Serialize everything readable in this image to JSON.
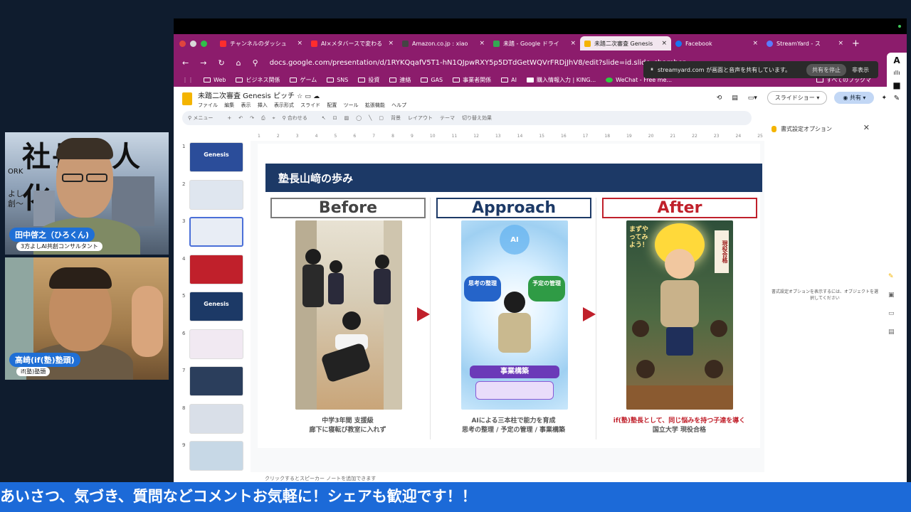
{
  "participants": [
    {
      "name": "田中啓之（ひろくん)",
      "role": "3方よしAI共創コンサルタント",
      "backdrop_text": "社長無人化",
      "backdrop_small": "ORK",
      "backdrop_small2": "よし\n創〜"
    },
    {
      "name": "高崎(if(塾)塾頭)",
      "role": "if(塾)塾頭"
    }
  ],
  "browser": {
    "tabs": [
      {
        "label": "チャンネルのダッシュ",
        "fav_color": "#ff2d2d"
      },
      {
        "label": "AI×メタバースで変わる",
        "fav_color": "#ff2d2d"
      },
      {
        "label": "Amazon.co.jp : xiao",
        "fav_color": "#333333"
      },
      {
        "label": "未踏 - Google ドライ",
        "fav_color": "#34a853"
      },
      {
        "label": "未踏二次審査 Genesis",
        "fav_color": "#f4b400"
      },
      {
        "label": "Facebook",
        "fav_color": "#1877f2"
      },
      {
        "label": "StreamYard - ス",
        "fav_color": "#5a7bff"
      }
    ],
    "url": "docs.google.com/presentation/d/1RYKQqafV5T1-hN1QJpwRXY5p5DTdGetWQVrFRDjJhV8/edit?slide=id.slide_chamber_02c#slide",
    "bookmarks": [
      "Web",
      "ビジネス関係",
      "ゲーム",
      "SNS",
      "投資",
      "連絡",
      "GAS",
      "事業者関係",
      "AI",
      "購入情報入力 | KING...",
      "WeChat - Free me..."
    ],
    "bookmarks_end": "すべてのブックマ",
    "share_notice": "streamyard.com が画面と音声を共有しています。",
    "share_stop": "共有を停止",
    "share_hide": "非表示"
  },
  "slides_app": {
    "doc_title": "未踏二次審査 Genesis ピッチ",
    "menus": [
      "ファイル",
      "編集",
      "表示",
      "挿入",
      "表示形式",
      "スライド",
      "配置",
      "ツール",
      "拡張機能",
      "ヘルプ"
    ],
    "slideshow_label": "スライドショー",
    "share_label": "共有",
    "toolbar_items": [
      "メニュー",
      "+",
      "合わせる",
      "背景",
      "レイアウト",
      "テーマ",
      "切り替え効果"
    ],
    "ruler_ticks": [
      "1",
      "2",
      "3",
      "4",
      "5",
      "6",
      "7",
      "8",
      "9",
      "10",
      "11",
      "12",
      "13",
      "14",
      "15",
      "16",
      "17",
      "18",
      "19",
      "20",
      "21",
      "22",
      "23",
      "24",
      "25"
    ],
    "thumbnails": [
      {
        "num": "1",
        "title": "Genesis",
        "color": "#2b4d9a"
      },
      {
        "num": "2",
        "title": "",
        "color": "#dfe6ef"
      },
      {
        "num": "3",
        "title": "",
        "color": "#e8edf5"
      },
      {
        "num": "4",
        "title": "",
        "color": "#c0202b"
      },
      {
        "num": "5",
        "title": "Genesis",
        "color": "#1c3966"
      },
      {
        "num": "6",
        "title": "",
        "color": "#f1e9f2"
      },
      {
        "num": "7",
        "title": "",
        "color": "#2b3e5c"
      },
      {
        "num": "8",
        "title": "",
        "color": "#d9dfe8"
      },
      {
        "num": "9",
        "title": "",
        "color": "#c7d8e6"
      }
    ],
    "speaker_notes_placeholder": "クリックするとスピーカー ノートを追加できます",
    "format_panel": {
      "title": "書式設定オプション",
      "message": "書式設定オプションを表示するには、オブジェクトを選択してください"
    }
  },
  "slide": {
    "title": "塾長山﨑の歩み",
    "columns": [
      {
        "label": "Before",
        "caption_line1": "中学3年間 支援級",
        "caption_line2": "廊下に寝転び教室に入れず"
      },
      {
        "label": "Approach",
        "caption_line1": "AIによる三本柱で能力を育成",
        "caption_line2": "思考の整理 / 予定の管理 / 事業構築"
      },
      {
        "label": "After",
        "caption_line1": "if(塾)塾長として、同じ悩みを持つ子達を導く",
        "caption_line2": "国立大学 現役合格"
      }
    ],
    "approach_chips": [
      "思考の整理",
      "予定の管理",
      "事業構築",
      "AI"
    ],
    "after_board_text": "まずやってみよう！",
    "after_board_sign": "現役合格"
  },
  "ticker": "あいさつ、気づき、質問などコメントお気軽に！シェアも歓迎です！！",
  "colors": {
    "accent_navy": "#1c3966",
    "accent_red": "#c0202b",
    "browser_chrome": "#8c1c6c",
    "ticker_blue": "#1c6ad8"
  }
}
